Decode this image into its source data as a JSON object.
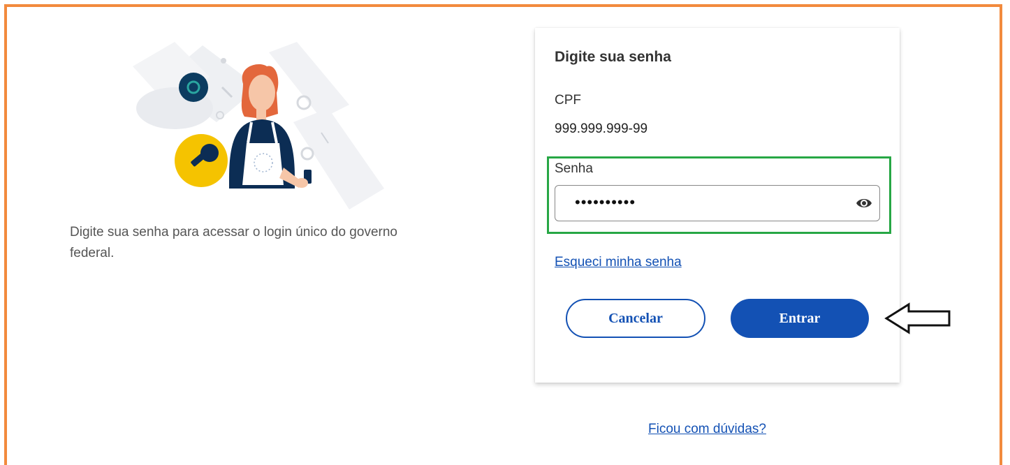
{
  "intro": {
    "text": "Digite sua senha para acessar o login único do governo federal."
  },
  "card": {
    "title": "Digite sua senha",
    "cpf_label": "CPF",
    "cpf_value": "999.999.999-99",
    "password_label": "Senha",
    "password_value": "••••••••••",
    "show_password_icon": "eye-icon",
    "forgot_link": "Esqueci minha senha",
    "cancel_label": "Cancelar",
    "enter_label": "Entrar"
  },
  "help_link": "Ficou com dúvidas?",
  "colors": {
    "frame": "#f28a3d",
    "primary": "#1351b4",
    "highlight": "#27a745"
  }
}
